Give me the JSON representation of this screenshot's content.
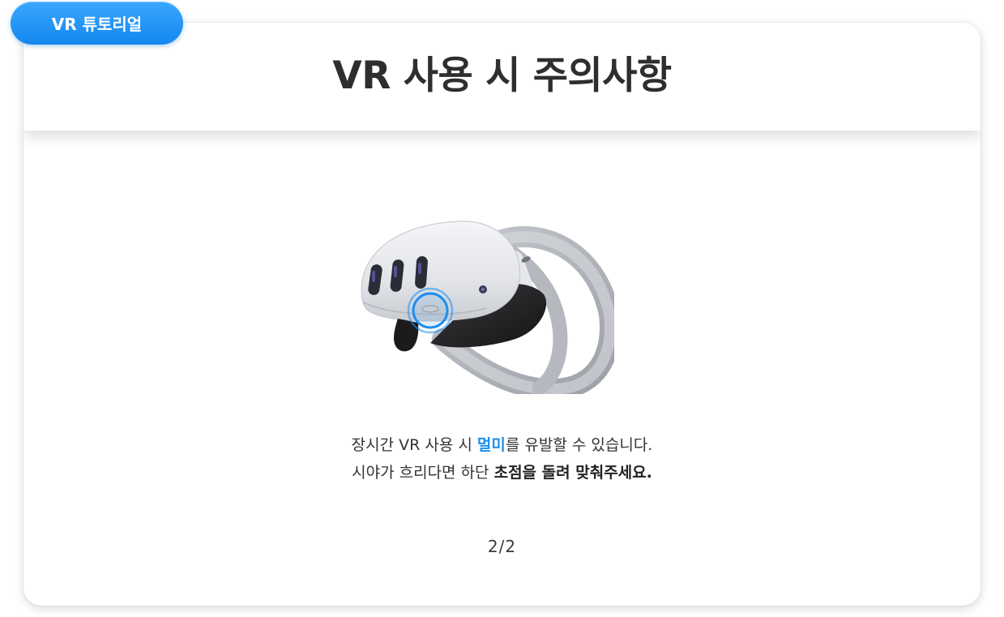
{
  "badge": {
    "label": "VR 튜토리얼"
  },
  "header": {
    "title": "VR 사용 시 주의사항"
  },
  "illustration": {
    "subject": "vr-headset",
    "highlight": "focus-dial"
  },
  "message": {
    "line1": {
      "before": "장시간 VR 사용 시 ",
      "highlight": "멀미",
      "after": "를 유발할 수 있습니다."
    },
    "line2": {
      "before": "시야가 흐리다면 하단 ",
      "emphasis": "초점을 돌려 맞춰주세요."
    }
  },
  "pager": {
    "text": "2/2"
  },
  "colors": {
    "accent": "#1c8ef0",
    "badge_top": "#3aa7ff",
    "badge_bottom": "#1487ee",
    "title": "#2e2e2e",
    "text": "#333333"
  }
}
